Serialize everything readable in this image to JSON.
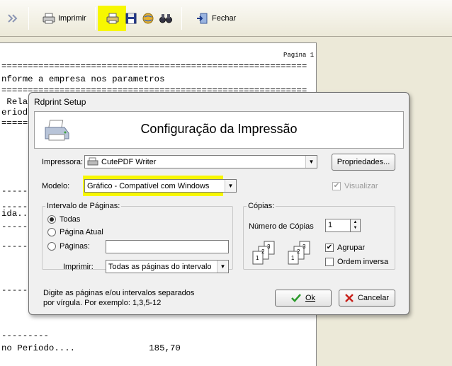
{
  "toolbar": {
    "nav_icon": "double-chevron-right-icon",
    "print_label": "Imprimir",
    "close_label": "Fechar",
    "highlight_color": "#f7f700"
  },
  "report": {
    "page_label": "Pagina 1",
    "lines": [
      "==========================================================",
      "nforme a empresa nos parametros",
      "==========================================================",
      " Rela",
      "eriodo",
      "======",
      "-------",
      "---------",
      "ida...",
      "---------",
      "---------",
      "",
      "---------",
      "",
      "---------",
      "no Periodo....              185,70"
    ]
  },
  "dialog": {
    "title": "Rdprint Setup",
    "header_title": "Configuração da Impressão",
    "printer_label": "Impressora:",
    "printer_value": "CutePDF Writer",
    "properties_button": "Propriedades...",
    "model_label": "Modelo:",
    "model_value": "Gráfico - Compatível com Windows",
    "model_highlight": "#f7f700",
    "preview_label": "Visualizar",
    "preview_checked": true,
    "page_range_group": "Intervalo de Páginas:",
    "radio_all": "Todas",
    "radio_current": "Página Atual",
    "radio_pages": "Páginas:",
    "pages_value": "",
    "print_label": "Imprimir:",
    "print_value": "Todas as páginas do intervalo",
    "copies_group": "Cópias:",
    "copies_label": "Número de Cópias",
    "copies_value": "1",
    "collate_label": "Agrupar",
    "collate_checked": true,
    "reverse_label": "Ordem inversa",
    "reverse_checked": false,
    "hint_line1": "Digite as páginas e/ou intervalos separados",
    "hint_line2": "por vírgula.  Por exemplo: 1,3,5-12",
    "ok_button": "Ok",
    "cancel_button": "Cancelar"
  }
}
